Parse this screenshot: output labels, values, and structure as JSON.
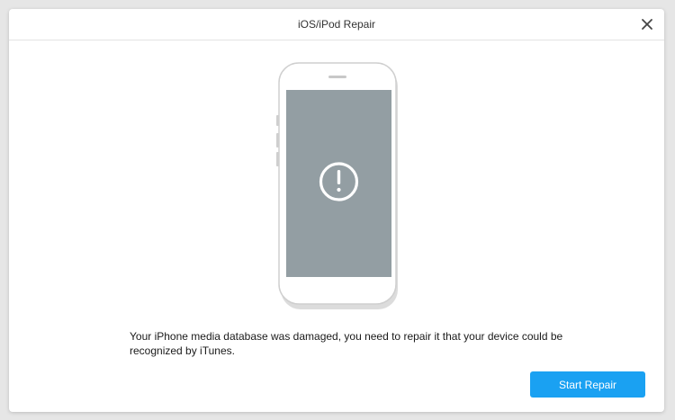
{
  "window": {
    "title": "iOS/iPod Repair",
    "close_icon": "close-icon"
  },
  "illustration": {
    "device": "phone-icon",
    "alert_icon": "exclamation-circle-icon",
    "screen_color": "#939ea3"
  },
  "message": {
    "text": "Your iPhone media database was  damaged,  you need to repair it that your device could be recognized by iTunes."
  },
  "actions": {
    "start_repair_label": "Start Repair",
    "accent_color": "#1aa1f2"
  }
}
